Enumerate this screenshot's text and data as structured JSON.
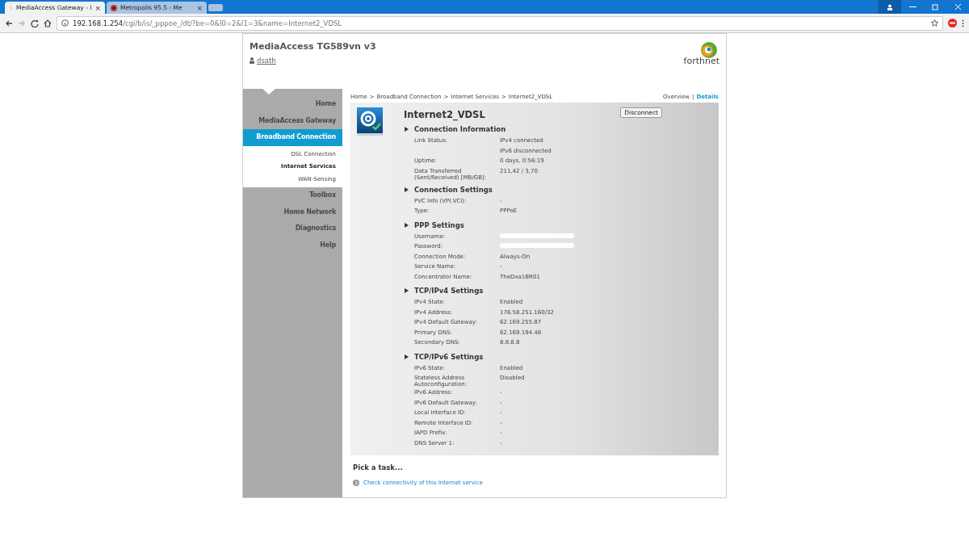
{
  "browser": {
    "tabs": [
      {
        "title": "MediaAccess Gateway - I",
        "selected": true,
        "close": "×"
      },
      {
        "title": "Metropolis 95.5 - Me",
        "selected": false,
        "close": "×"
      }
    ],
    "url_host": "192.168.1.254",
    "url_path": "/cgi/b/is/_pppoe_/dt/?be=0&l0=2&l1=3&name=Internet2_VDSL"
  },
  "header": {
    "title": "MediaAccess TG589vn v3",
    "user": "dsath",
    "logo": "forthnet"
  },
  "sidebar": {
    "items": [
      {
        "label": "Home",
        "selected": false
      },
      {
        "label": "MediaAccess Gateway",
        "selected": false
      },
      {
        "label": "Broadband Connection",
        "selected": true,
        "children": [
          {
            "label": "DSL Connection",
            "selected": false
          },
          {
            "label": "Internet Services",
            "selected": true
          },
          {
            "label": "WAN-Sensing",
            "selected": false
          }
        ]
      },
      {
        "label": "Toolbox",
        "selected": false
      },
      {
        "label": "Home Network",
        "selected": false
      },
      {
        "label": "Diagnostics",
        "selected": false
      },
      {
        "label": "Help",
        "selected": false
      }
    ]
  },
  "breadcrumb": [
    "Home",
    "Broadband Connection",
    "Internet Services",
    "Internet2_VDSL"
  ],
  "breadcrumb_separator": ">",
  "views": [
    {
      "label": "Overview",
      "selected": false
    },
    {
      "label": "Details",
      "selected": true
    }
  ],
  "view_separator": "|",
  "service": {
    "title": "Internet2_VDSL",
    "button": "Disconnect",
    "sections": [
      {
        "title": "Connection Information",
        "rows": [
          {
            "label": "Link Status:",
            "value": "IPv4 connected"
          },
          {
            "value": "IPv6 disconnected"
          },
          {
            "label": "Uptime:",
            "value": "0 days, 0:56:19"
          },
          {
            "label": "Data Transferred (Sent/Received) [MB/GB]:",
            "value": "211,42 / 3,70"
          }
        ]
      },
      {
        "title": "Connection Settings",
        "rows": [
          {
            "label": "PVC Info (VPI.VCI):",
            "value": "-"
          },
          {
            "label": "Type:",
            "value": "PPPoE"
          }
        ]
      },
      {
        "title": "PPP Settings",
        "rows": [
          {
            "label": "Username:",
            "kind": "redacted"
          },
          {
            "label": "Password:",
            "kind": "redacted"
          },
          {
            "label": "Connection Mode:",
            "value": "Always-On"
          },
          {
            "label": "Service Name:",
            "value": "-"
          },
          {
            "label": "Concentrator Name:",
            "value": "TheDxa1BR01"
          }
        ]
      },
      {
        "title": "TCP/IPv4 Settings",
        "rows": [
          {
            "label": "IPv4 State:",
            "value": "Enabled"
          },
          {
            "label": "IPv4 Address:",
            "value": "176.58.251.160/32"
          },
          {
            "label": "IPv4 Default Gateway:",
            "value": "62.169.255.87"
          },
          {
            "label": "Primary DNS:",
            "value": "62.169.194.48"
          },
          {
            "label": "Secondary DNS:",
            "value": "8.8.8.8"
          }
        ]
      },
      {
        "title": "TCP/IPv6 Settings",
        "rows": [
          {
            "label": "IPv6 State:",
            "value": "Enabled"
          },
          {
            "label": "Stateless Address Autoconfiguration:",
            "value": "Disabled"
          },
          {
            "label": "IPv6 Address:",
            "value": "-"
          },
          {
            "label": "IPv6 Default Gateway:",
            "value": "-"
          },
          {
            "label": "Local Interface ID:",
            "value": "-"
          },
          {
            "label": "Remote Interface ID:",
            "value": "-"
          },
          {
            "label": "IAPD Prefix:",
            "value": "-"
          },
          {
            "label": "DNS Server 1:",
            "value": "-"
          }
        ]
      }
    ]
  },
  "tasks": {
    "title": "Pick a task...",
    "links": [
      "Check connectivity of this Internet service"
    ]
  }
}
